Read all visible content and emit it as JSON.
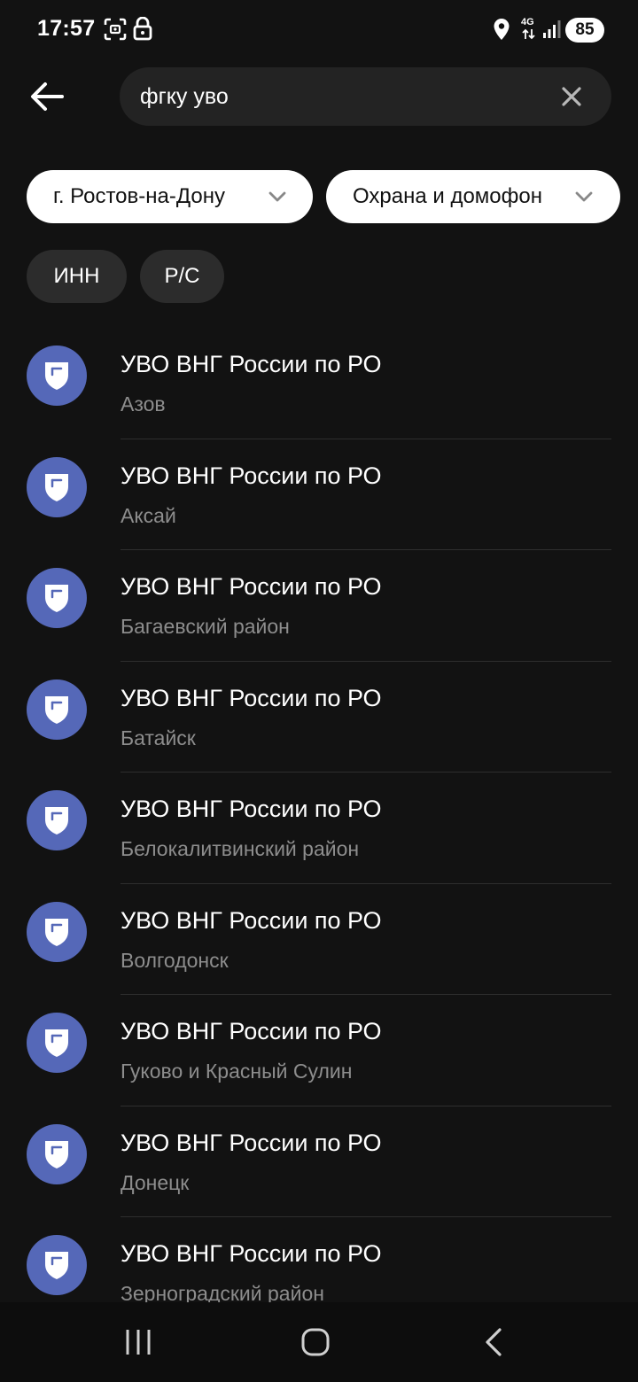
{
  "status_bar": {
    "time": "17:57",
    "network": "4G",
    "battery": "85",
    "icons": [
      "screenshot-icon",
      "lock-icon",
      "location-icon",
      "data-arrows-icon",
      "signal-icon"
    ]
  },
  "search": {
    "value": "фгку уво",
    "back_icon": "arrow-left-icon",
    "clear_icon": "close-icon"
  },
  "filters": {
    "city": "г. Ростов-на-Дону",
    "category": "Охрана и домофон",
    "tags": [
      "ИНН",
      "Р/С"
    ]
  },
  "results": [
    {
      "title": "УВО ВНГ России по РО",
      "subtitle": "Азов"
    },
    {
      "title": "УВО ВНГ России по РО",
      "subtitle": "Аксай"
    },
    {
      "title": "УВО ВНГ России по РО",
      "subtitle": "Багаевский район"
    },
    {
      "title": "УВО ВНГ России по РО",
      "subtitle": "Батайск"
    },
    {
      "title": "УВО ВНГ России по РО",
      "subtitle": "Белокалитвинский район"
    },
    {
      "title": "УВО ВНГ России по РО",
      "subtitle": "Волгодонск"
    },
    {
      "title": "УВО ВНГ России по РО",
      "subtitle": "Гуково и Красный Сулин"
    },
    {
      "title": "УВО ВНГ России по РО",
      "subtitle": "Донецк"
    },
    {
      "title": "УВО ВНГ России по РО",
      "subtitle": "Зерноградский район"
    }
  ],
  "colors": {
    "background": "#121212",
    "avatar": "#5568b8",
    "subtitle": "#8d8d8d"
  },
  "nav_bar": {
    "icons": [
      "recents-icon",
      "home-icon",
      "back-icon"
    ]
  }
}
